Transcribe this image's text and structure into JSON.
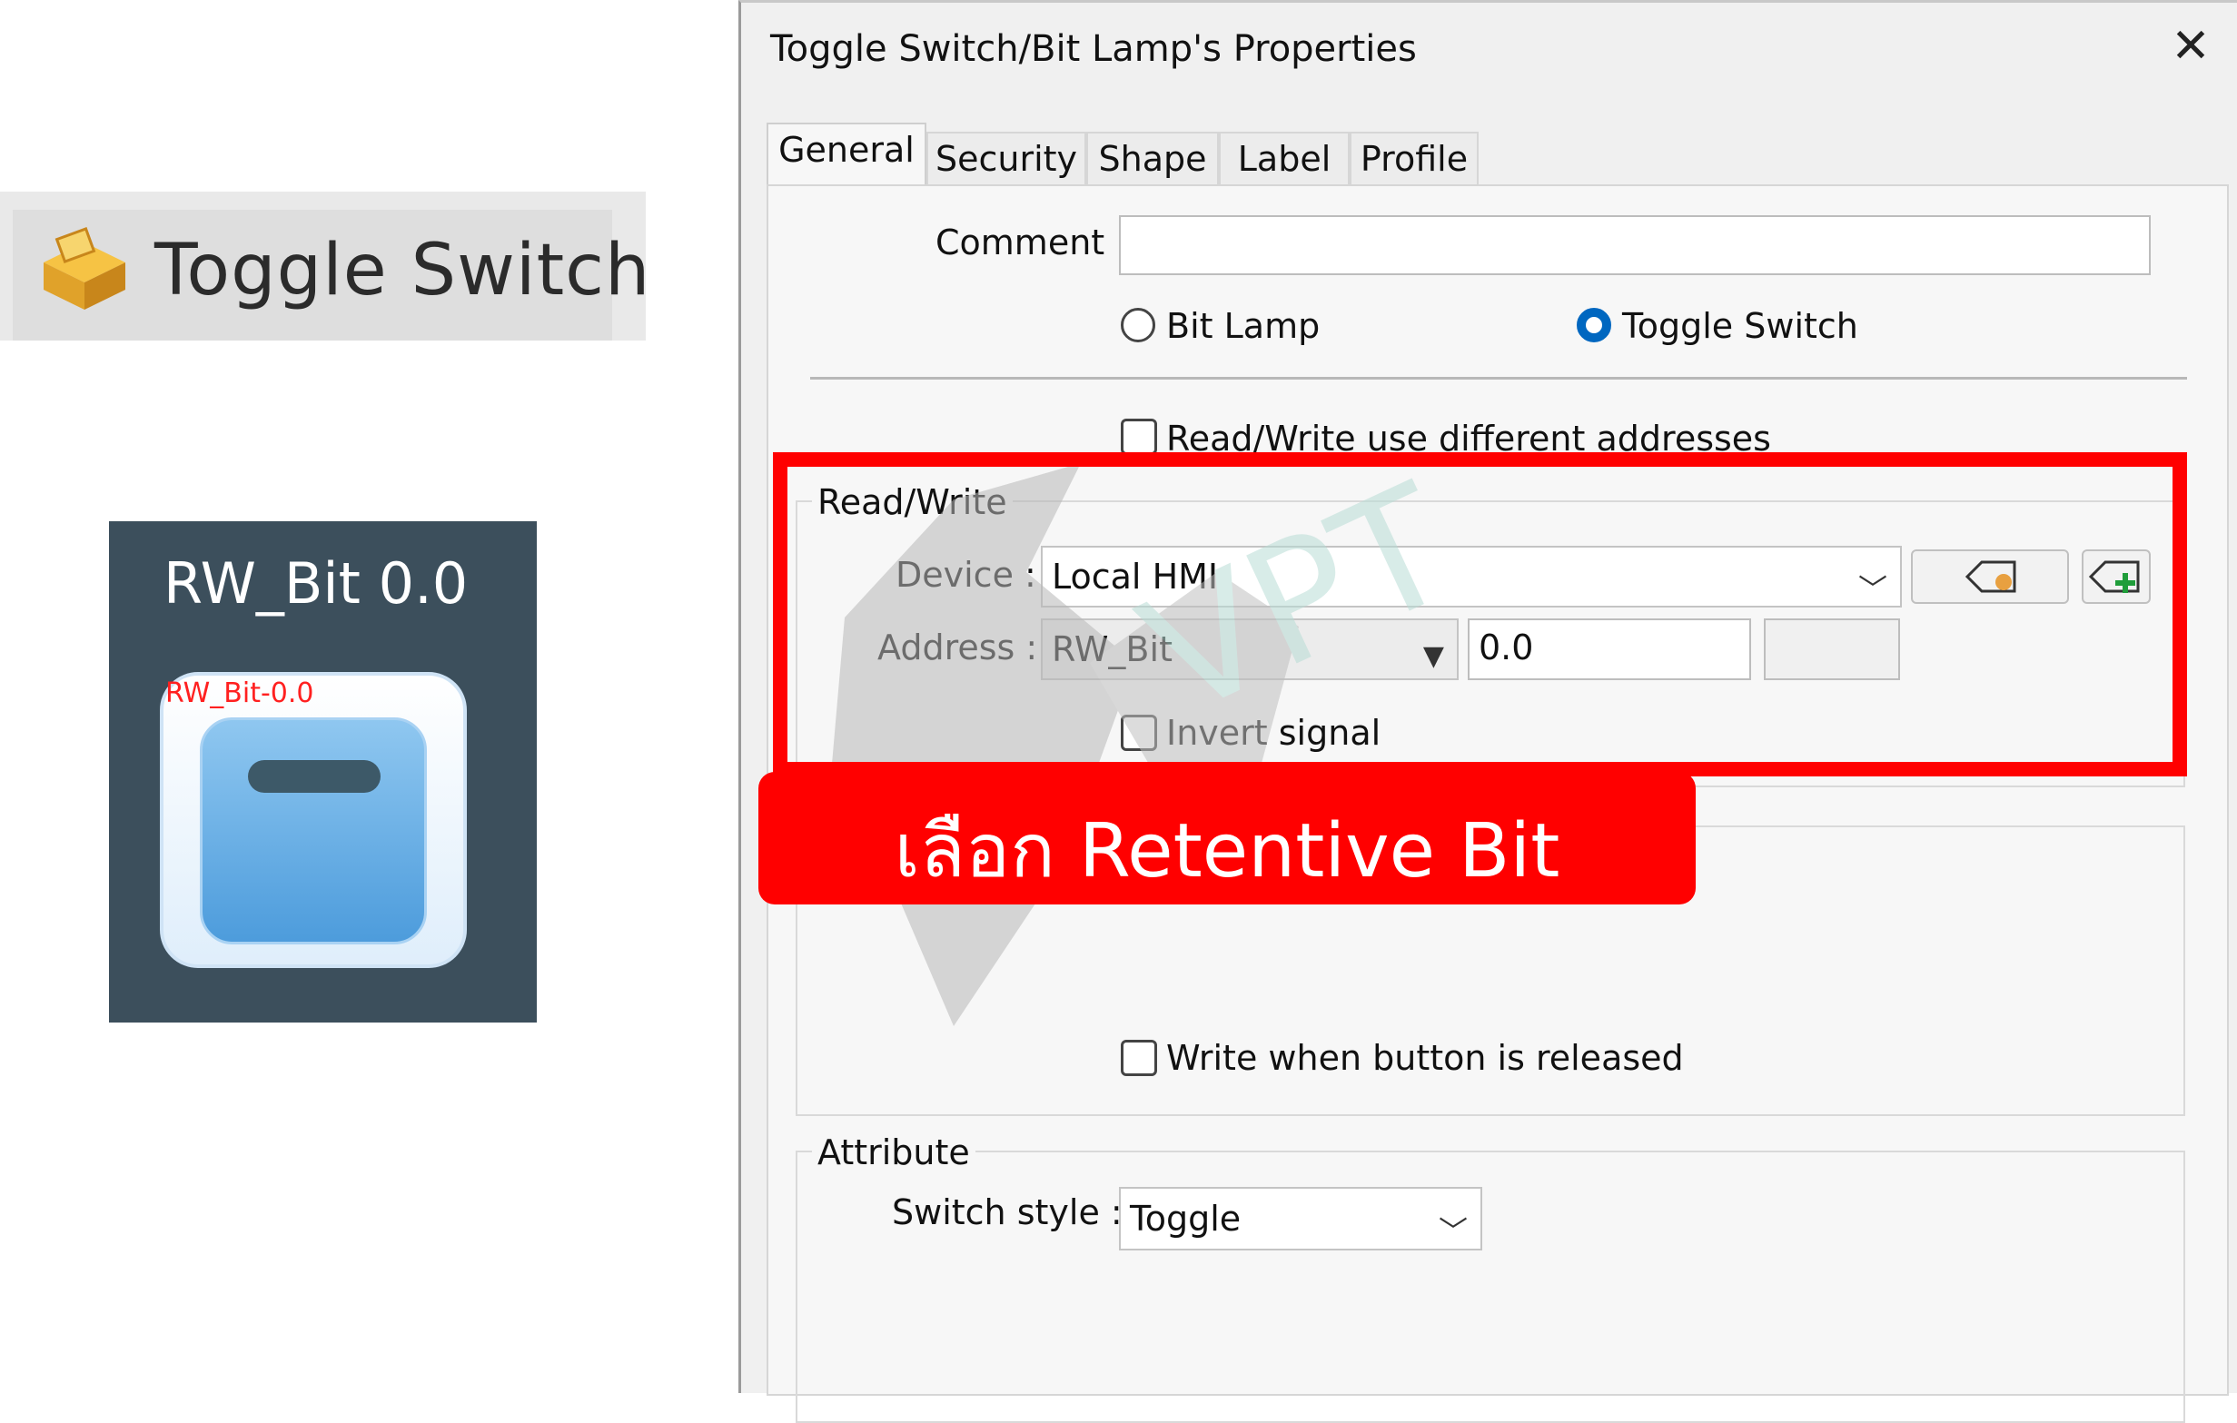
{
  "toolbar_item": {
    "label": "Toggle Switch",
    "icon": "toggle-switch-icon"
  },
  "preview": {
    "title": "RW_Bit 0.0",
    "address_tag": "RW_Bit-0.0"
  },
  "dialog": {
    "title": "Toggle Switch/Bit Lamp's Properties",
    "close_icon": "close-icon",
    "tabs": [
      {
        "label": "General",
        "active": true
      },
      {
        "label": "Security"
      },
      {
        "label": "Shape"
      },
      {
        "label": "Label"
      },
      {
        "label": "Profile"
      }
    ],
    "comment": {
      "label": "Comment :",
      "value": ""
    },
    "mode": {
      "bit_lamp": {
        "label": "Bit Lamp",
        "checked": false
      },
      "toggle_switch": {
        "label": "Toggle Switch",
        "checked": true
      }
    },
    "rw_different": {
      "label": "Read/Write use different addresses",
      "checked": false
    },
    "read_write": {
      "title": "Read/Write",
      "device_label": "Device :",
      "device_value": "Local HMI",
      "address_label": "Address :",
      "address_type": "RW_Bit",
      "address_value": "0.0",
      "address_extra": "",
      "invert_signal": {
        "label": "Invert signal",
        "checked": false
      }
    },
    "write_when_released": {
      "label": "Write when button is released",
      "checked": false
    },
    "attribute": {
      "title": "Attribute",
      "switch_style_label": "Switch style :",
      "switch_style_value": "Toggle"
    }
  },
  "annotation": {
    "banner_text": "เลือก Retentive Bit",
    "highlight_color": "#ff0000"
  }
}
